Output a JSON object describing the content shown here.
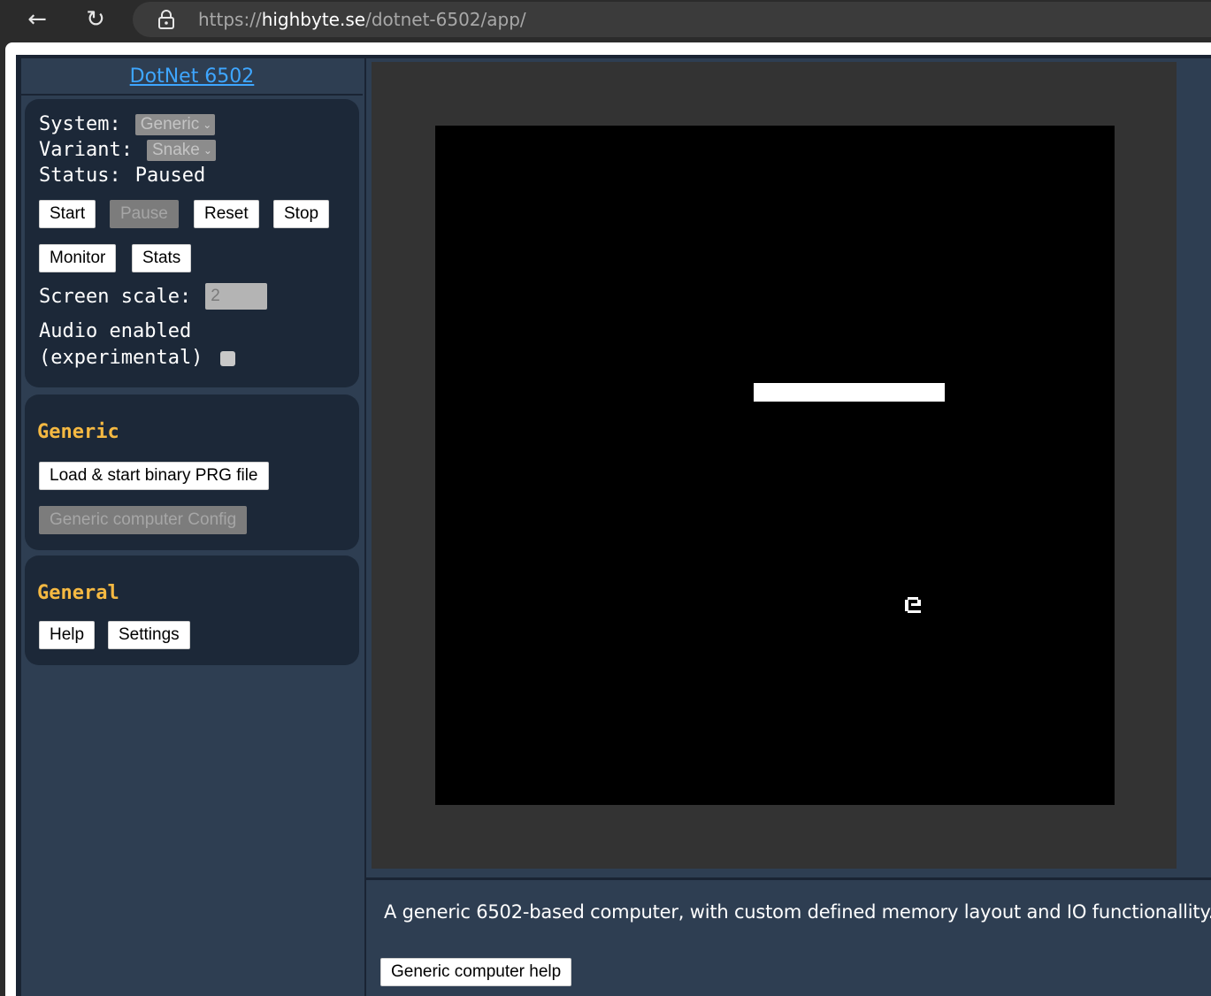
{
  "browser": {
    "url_scheme": "https://",
    "url_host": "highbyte.se",
    "url_path": "/dotnet-6502/app/"
  },
  "app": {
    "title": "DotNet 6502",
    "system": {
      "system_label": "System:",
      "system_value": "Generic",
      "variant_label": "Variant:",
      "variant_value": "Snake",
      "status_label": "Status:",
      "status_value": "Paused",
      "buttons": {
        "start": "Start",
        "pause": "Pause",
        "reset": "Reset",
        "stop": "Stop",
        "monitor": "Monitor",
        "stats": "Stats"
      },
      "screen_scale_label": "Screen scale:",
      "screen_scale_value": "2",
      "audio_label_line1": "Audio enabled",
      "audio_label_line2": "(experimental)",
      "audio_enabled": false
    },
    "generic_section": {
      "heading": "Generic",
      "load_button": "Load & start binary PRG file",
      "config_button": "Generic computer Config"
    },
    "general_section": {
      "heading": "General",
      "help_button": "Help",
      "settings_button": "Settings"
    },
    "description": "A generic 6502-based computer, with custom defined memory layout and IO functionallity.",
    "help_button": "Generic computer help"
  },
  "colors": {
    "accent_heading": "#f5b942",
    "title_link": "#3ea6ff",
    "panel_bg": "#1c2838",
    "app_bg": "#2e3e52",
    "screen_bg": "#000000"
  },
  "icons": {
    "back": "arrow-left",
    "reload": "reload-arrow",
    "lock": "lock",
    "select_chevron": "chevron-down",
    "food": "snake-food-glyph"
  }
}
